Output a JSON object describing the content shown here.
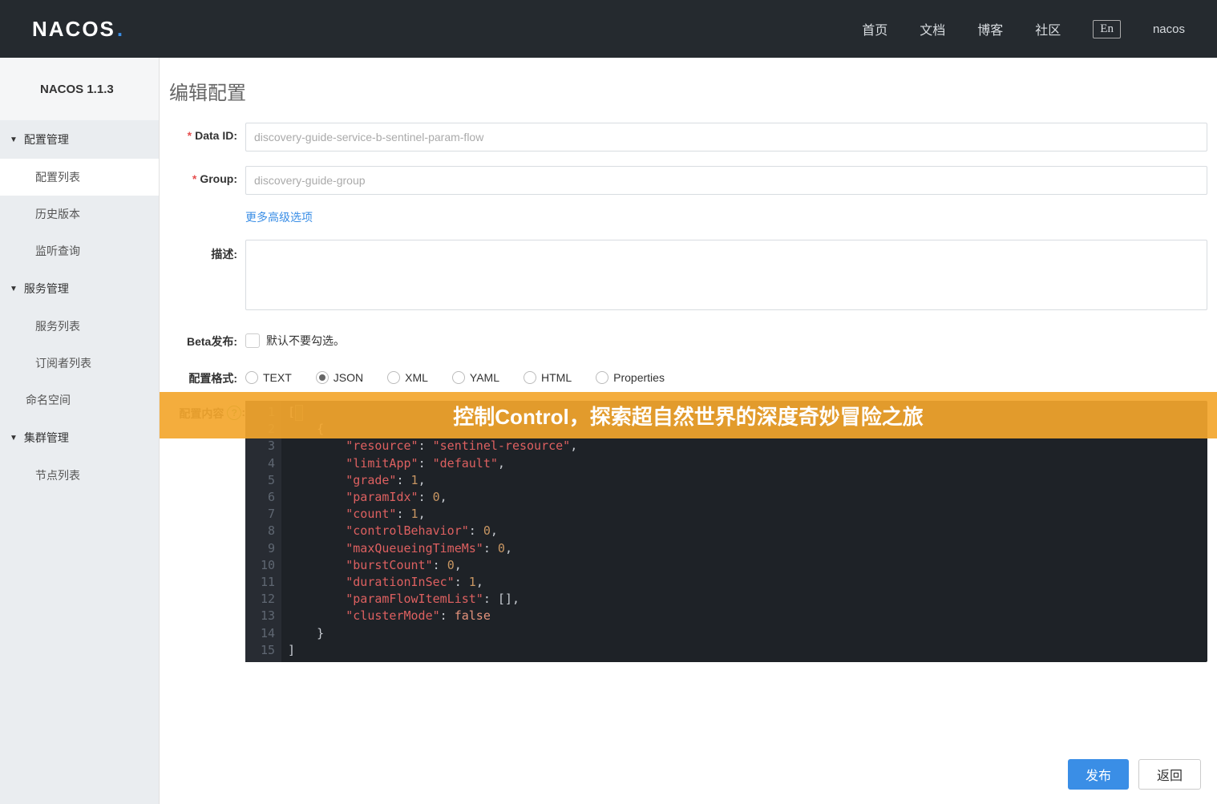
{
  "header": {
    "logo": "NACOS",
    "nav": [
      "首页",
      "文档",
      "博客",
      "社区"
    ],
    "lang": "En",
    "user": "nacos"
  },
  "sidebar": {
    "version": "NACOS 1.1.3",
    "groups": [
      {
        "label": "配置管理",
        "items": [
          "配置列表",
          "历史版本",
          "监听查询"
        ]
      },
      {
        "label": "服务管理",
        "items": [
          "服务列表",
          "订阅者列表"
        ]
      }
    ],
    "standalone_items": [
      "命名空间"
    ],
    "groups2": [
      {
        "label": "集群管理",
        "items": [
          "节点列表"
        ]
      }
    ]
  },
  "page": {
    "title": "编辑配置",
    "labels": {
      "dataId": "Data ID:",
      "group": "Group:",
      "more": "更多高级选项",
      "desc": "描述:",
      "beta": "Beta发布:",
      "betaHint": "默认不要勾选。",
      "format": "配置格式:",
      "content": "配置内容",
      "publish": "发布",
      "back": "返回"
    },
    "values": {
      "dataId": "discovery-guide-service-b-sentinel-param-flow",
      "group": "discovery-guide-group"
    },
    "formats": [
      "TEXT",
      "JSON",
      "XML",
      "YAML",
      "HTML",
      "Properties"
    ],
    "selectedFormat": "JSON"
  },
  "overlay": {
    "text": "控制Control，探索超自然世界的深度奇妙冒险之旅"
  },
  "editor": {
    "lines": 15,
    "content": [
      {
        "type": "plain",
        "text": "["
      },
      {
        "type": "plain",
        "text": "    {"
      },
      {
        "type": "kv_str",
        "indent": "        ",
        "key": "resource",
        "val": "sentinel-resource",
        "comma": true
      },
      {
        "type": "kv_str",
        "indent": "        ",
        "key": "limitApp",
        "val": "default",
        "comma": true
      },
      {
        "type": "kv_num",
        "indent": "        ",
        "key": "grade",
        "val": "1",
        "comma": true
      },
      {
        "type": "kv_num",
        "indent": "        ",
        "key": "paramIdx",
        "val": "0",
        "comma": true
      },
      {
        "type": "kv_num",
        "indent": "        ",
        "key": "count",
        "val": "1",
        "comma": true
      },
      {
        "type": "kv_num",
        "indent": "        ",
        "key": "controlBehavior",
        "val": "0",
        "comma": true
      },
      {
        "type": "kv_num",
        "indent": "        ",
        "key": "maxQueueingTimeMs",
        "val": "0",
        "comma": true
      },
      {
        "type": "kv_num",
        "indent": "        ",
        "key": "burstCount",
        "val": "0",
        "comma": true
      },
      {
        "type": "kv_num",
        "indent": "        ",
        "key": "durationInSec",
        "val": "1",
        "comma": true
      },
      {
        "type": "kv_raw",
        "indent": "        ",
        "key": "paramFlowItemList",
        "val": "[]",
        "comma": true
      },
      {
        "type": "kv_kw",
        "indent": "        ",
        "key": "clusterMode",
        "val": "false",
        "comma": false
      },
      {
        "type": "plain",
        "text": "    }"
      },
      {
        "type": "plain",
        "text": "]"
      }
    ]
  }
}
